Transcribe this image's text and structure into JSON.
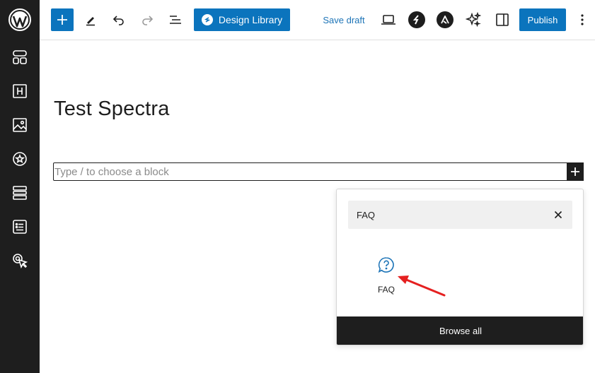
{
  "toolbar": {
    "design_library_label": "Design Library",
    "save_draft_label": "Save draft",
    "publish_label": "Publish"
  },
  "post": {
    "title": "Test Spectra",
    "block_placeholder": "Type / to choose a block"
  },
  "inserter": {
    "search_value": "FAQ",
    "results": [
      {
        "label": "FAQ",
        "icon": "faq-question-icon"
      }
    ],
    "browse_all_label": "Browse all"
  },
  "colors": {
    "accent": "#0b74bd",
    "dark": "#1e1e1e",
    "arrow": "#e52020"
  }
}
